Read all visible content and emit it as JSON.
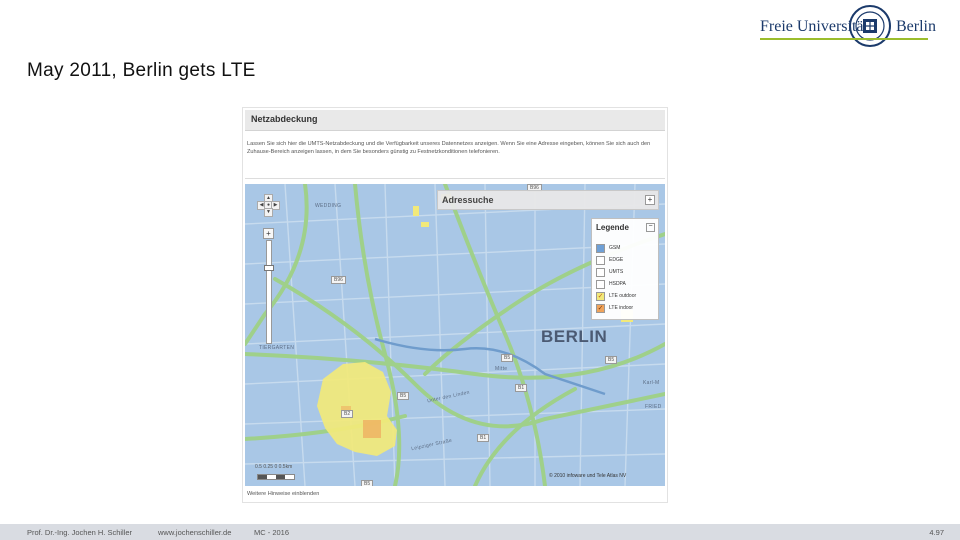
{
  "slide": {
    "title": "May 2011, Berlin gets LTE",
    "logo": {
      "left": "Freie Universität",
      "right": "Berlin"
    },
    "footer": {
      "author": "Prof. Dr.-Ing. Jochen H. Schiller",
      "website": "www.jochenschiller.de",
      "course": "MC - 2016",
      "page": "4.97"
    }
  },
  "panel": {
    "title": "Netzabdeckung",
    "description": "Lassen Sie sich hier die UMTS-Netzabdeckung und die Verfügbarkeit unseres Datennetzes anzeigen. Wenn Sie eine Adresse eingeben, können Sie sich auch den Zuhause-Bereich anzeigen lassen, in dem Sie besonders günstig zu Festnetzkonditionen telefonieren.",
    "address_search": "Adressuche",
    "legend": {
      "title": "Legende",
      "items": [
        {
          "label": "GSM",
          "checked": false,
          "color": "#6fa0d6"
        },
        {
          "label": "EDGE",
          "checked": false,
          "color": "#ffffff"
        },
        {
          "label": "UMTS",
          "checked": false,
          "color": "#ffffff"
        },
        {
          "label": "HSDPA",
          "checked": false,
          "color": "#ffffff"
        },
        {
          "label": "LTE outdoor",
          "checked": true,
          "color": "#f2e97a"
        },
        {
          "label": "LTE indoor",
          "checked": true,
          "color": "#f0a35a"
        }
      ]
    },
    "map_labels": {
      "city": "BERLIN",
      "wedding": "WEDDING",
      "tiergarten": "TIERGARTEN",
      "mitte": "Mitte",
      "friedrichshain": "FRIED",
      "karl_marx": "Karl-M",
      "unter_den_linden": "Unter den Linden",
      "leipziger": "Leipziger Straße"
    },
    "road_shields": [
      "B96",
      "B96",
      "B5",
      "B1",
      "B5",
      "B2",
      "B1",
      "B5",
      "B5"
    ],
    "scale_text": "0.5  0.25    0          0.5km",
    "copyright": "© 2010 infoware und Tele Atlas NV",
    "footer_link": "Weitere Hinweise einblenden"
  },
  "colors": {
    "map_base": "#a9c7e6",
    "lte_outdoor": "#f2e97a",
    "lte_indoor": "#f0a35a",
    "footer_bg": "#d9dce2"
  }
}
